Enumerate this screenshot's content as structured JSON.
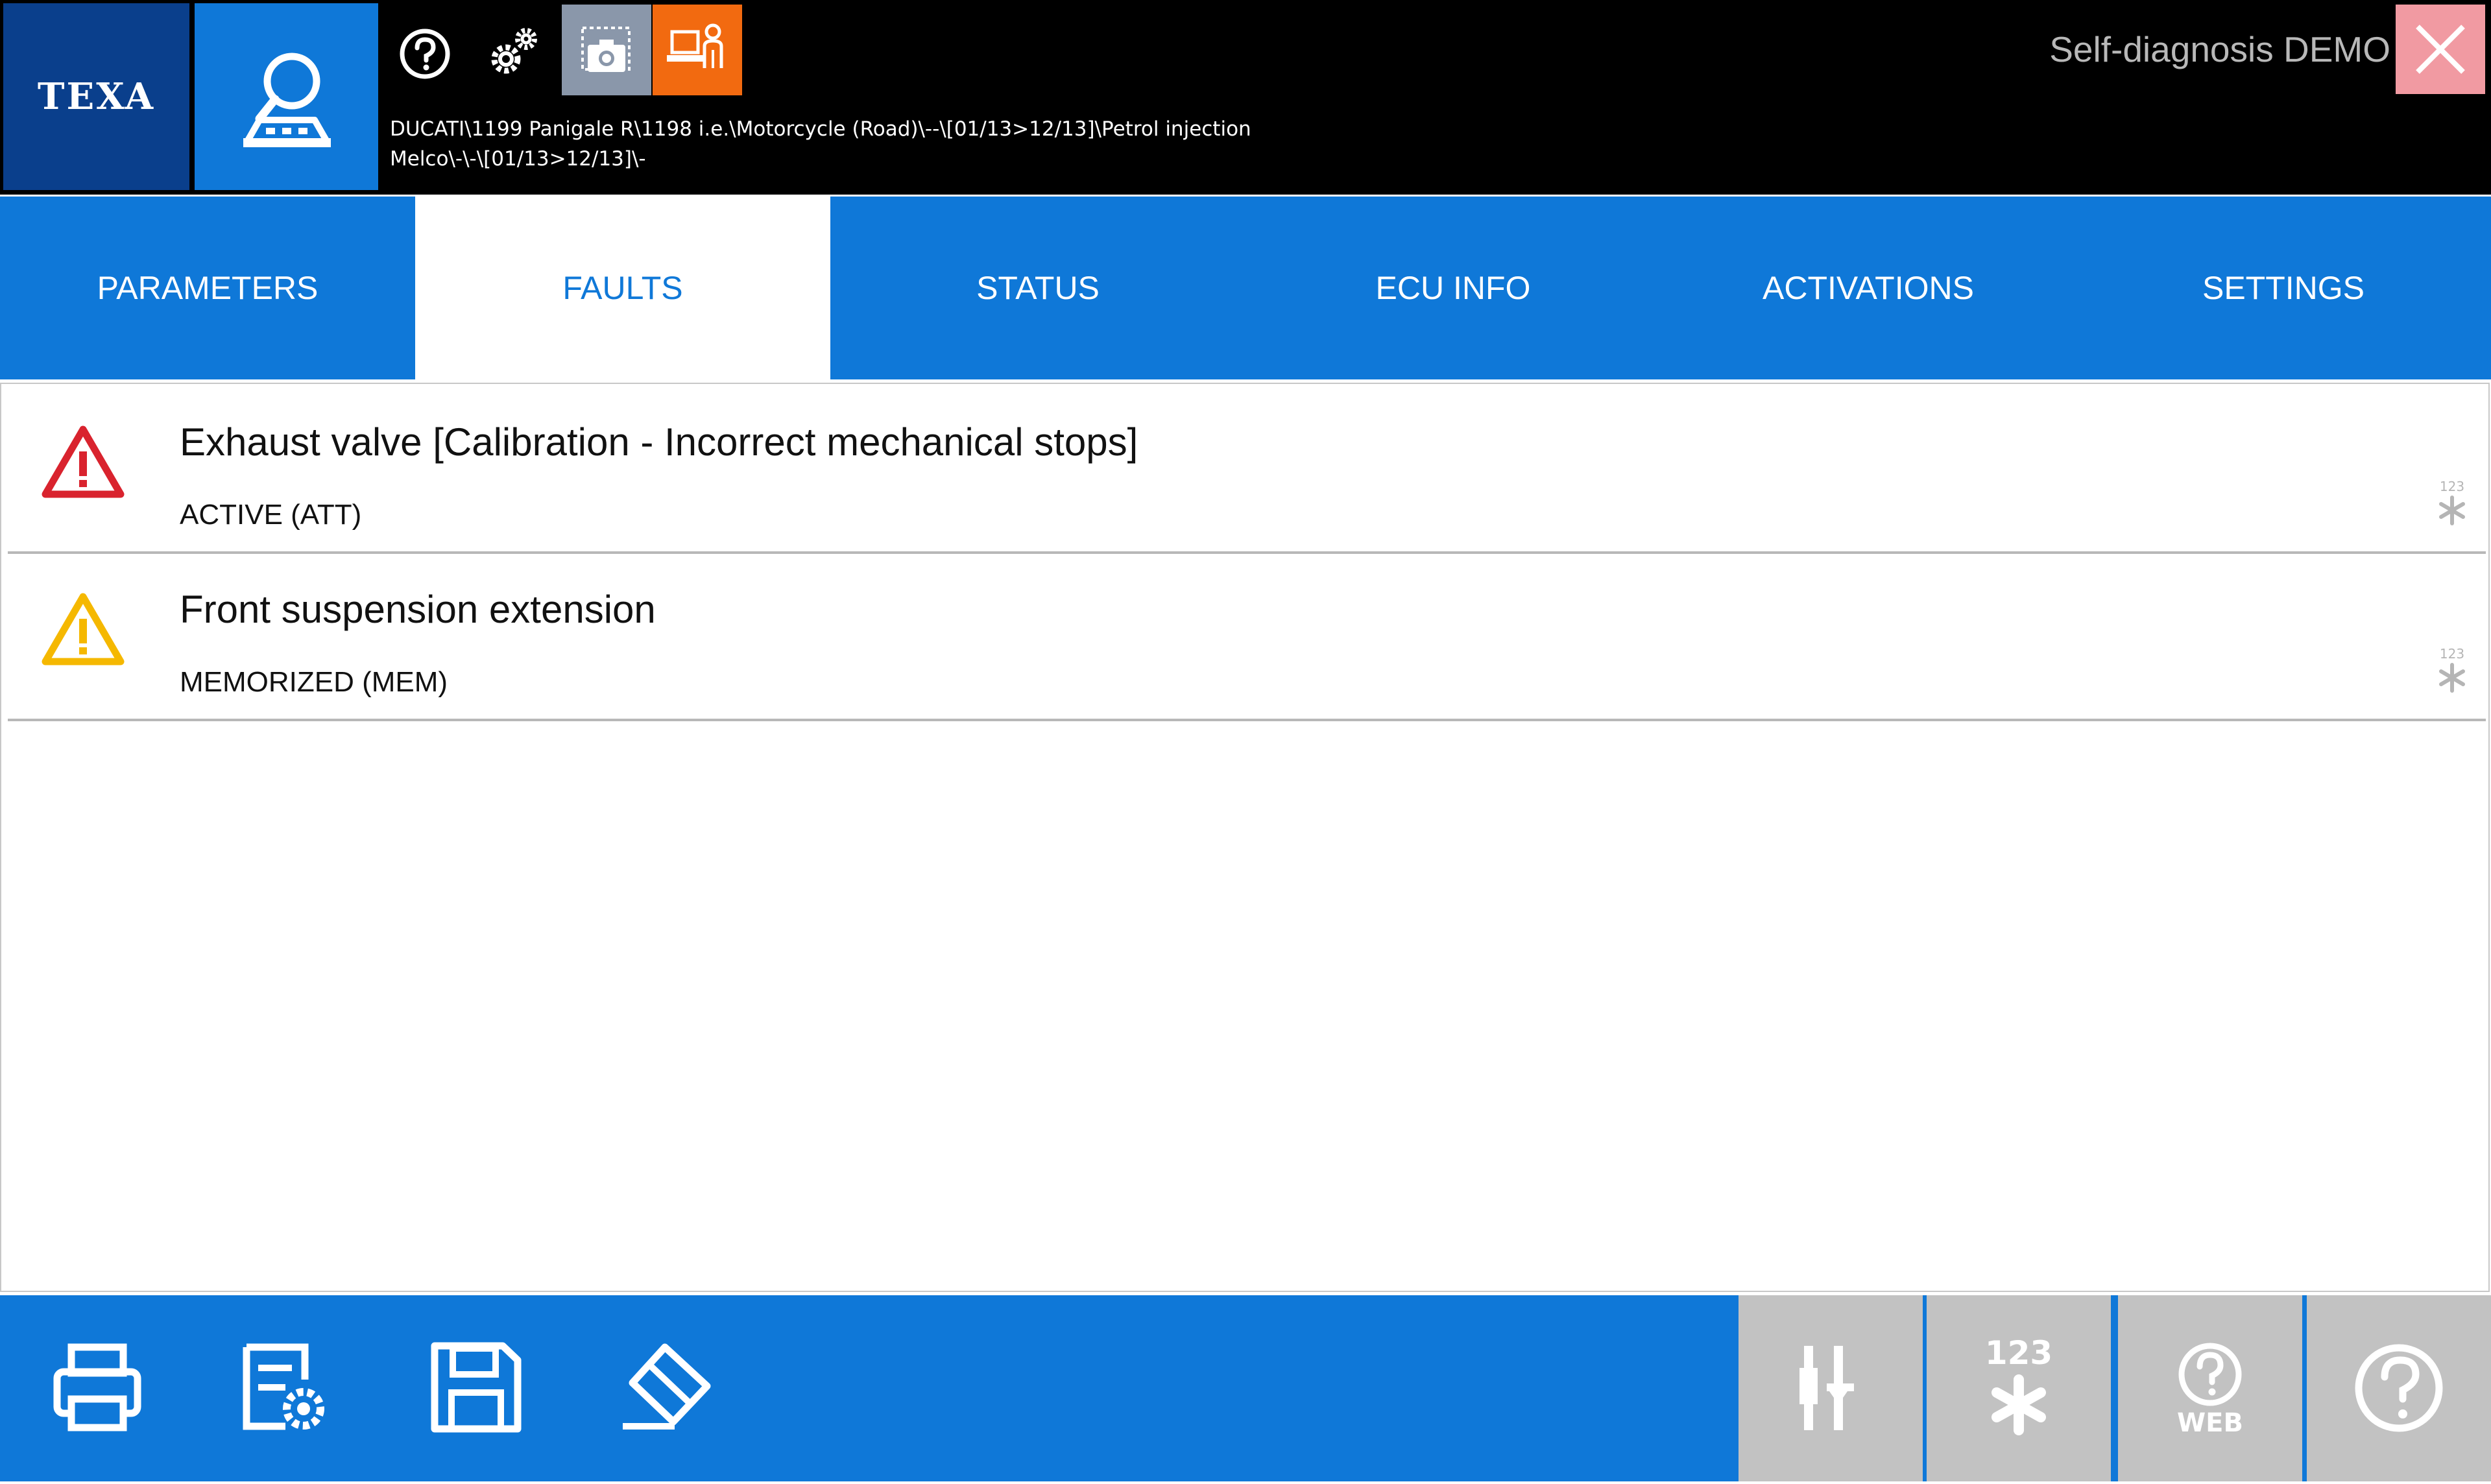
{
  "header": {
    "logo": "TEXA",
    "vehicle_path_line1": "DUCATI\\1199 Panigale R\\1198 i.e.\\Motorcycle (Road)\\--\\[01/13>12/13]\\Petrol injection",
    "vehicle_path_line2": "Melco\\-\\-\\[01/13>12/13]\\-",
    "window_title": "Self-diagnosis DEMO",
    "toolbar_icons": [
      "help-icon",
      "gears-icon",
      "screen-capture-icon",
      "remote-support-icon"
    ]
  },
  "tabs": [
    {
      "label": "PARAMETERS",
      "active": false
    },
    {
      "label": "FAULTS",
      "active": true
    },
    {
      "label": "STATUS",
      "active": false
    },
    {
      "label": "ECU INFO",
      "active": false
    },
    {
      "label": "ACTIVATIONS",
      "active": false
    },
    {
      "label": "SETTINGS",
      "active": false
    }
  ],
  "faults": [
    {
      "title": "Exhaust valve [Calibration - Incorrect mechanical stops]",
      "status": "ACTIVE (ATT)",
      "severity_color": "#d9232e",
      "code_badge": "123"
    },
    {
      "title": "Front suspension extension",
      "status": "MEMORIZED (MEM)",
      "severity_color": "#f5b800",
      "code_badge": "123"
    }
  ],
  "bottom_toolbar": {
    "left_icons": [
      "print-icon",
      "report-settings-icon",
      "save-icon",
      "erase-icon"
    ],
    "right_icons": [
      "filter-icon",
      "fault-codes-icon",
      "web-help-icon",
      "help-icon"
    ],
    "codes_label": "123",
    "web_label": "WEB"
  },
  "colors": {
    "primary_blue": "#0f78d8",
    "logo_blue": "#0a3f8c",
    "capture_gray": "#8a97aa",
    "remote_orange": "#f26a10",
    "close_pink": "#f19aa2",
    "button_gray": "#c2c2c2"
  }
}
